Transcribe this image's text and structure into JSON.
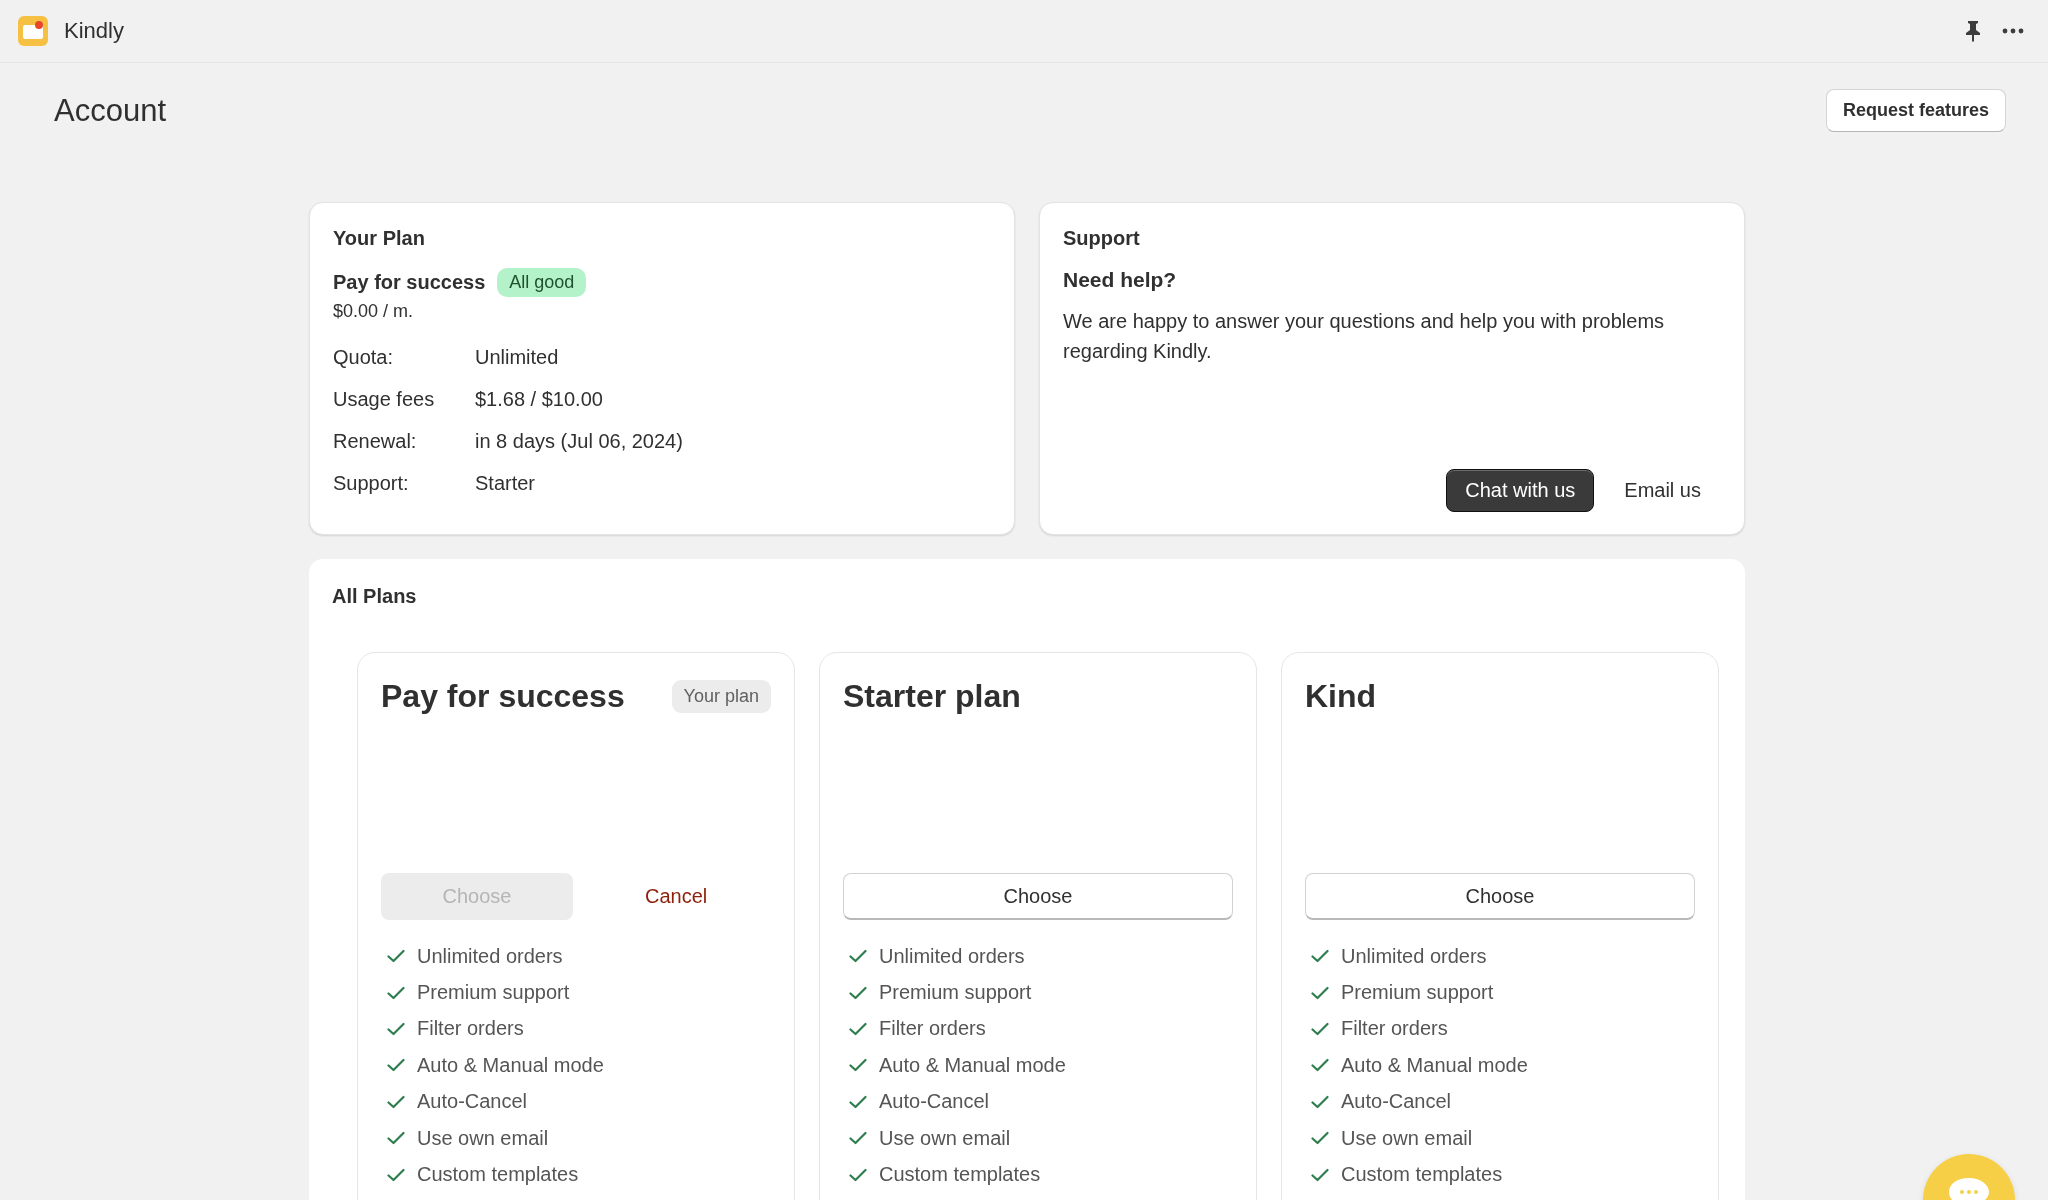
{
  "app": {
    "name": "Kindly"
  },
  "page": {
    "title": "Account",
    "action": "Request features"
  },
  "your_plan": {
    "title": "Your Plan",
    "plan_name": "Pay for success",
    "status": "All good",
    "price": "$0.00 / m.",
    "details": [
      {
        "label": "Quota:",
        "value": "Unlimited"
      },
      {
        "label": "Usage fees",
        "value": "$1.68 / $10.00"
      },
      {
        "label": "Renewal:",
        "value": "in 8 days (Jul 06, 2024)"
      },
      {
        "label": "Support:",
        "value": "Starter"
      }
    ]
  },
  "support": {
    "title": "Support",
    "heading": "Need help?",
    "text": "We are happy to answer your questions and help you with problems regarding Kindly.",
    "primary_button": "Chat with us",
    "secondary_button": "Email us"
  },
  "all_plans": {
    "title": "All Plans",
    "plans": [
      {
        "name": "Pay for success",
        "current": true,
        "badge": "Your plan",
        "choose": "Choose",
        "cancel": "Cancel",
        "features": [
          "Unlimited orders",
          "Premium support",
          "Filter orders",
          "Auto & Manual mode",
          "Auto-Cancel",
          "Use own email",
          "Custom templates"
        ]
      },
      {
        "name": "Starter plan",
        "current": false,
        "choose": "Choose",
        "features": [
          "Unlimited orders",
          "Premium support",
          "Filter orders",
          "Auto & Manual mode",
          "Auto-Cancel",
          "Use own email",
          "Custom templates"
        ]
      },
      {
        "name": "Kind",
        "current": false,
        "choose": "Choose",
        "features": [
          "Unlimited orders",
          "Premium support",
          "Filter orders",
          "Auto & Manual mode",
          "Auto-Cancel",
          "Use own email",
          "Custom templates"
        ]
      }
    ]
  }
}
